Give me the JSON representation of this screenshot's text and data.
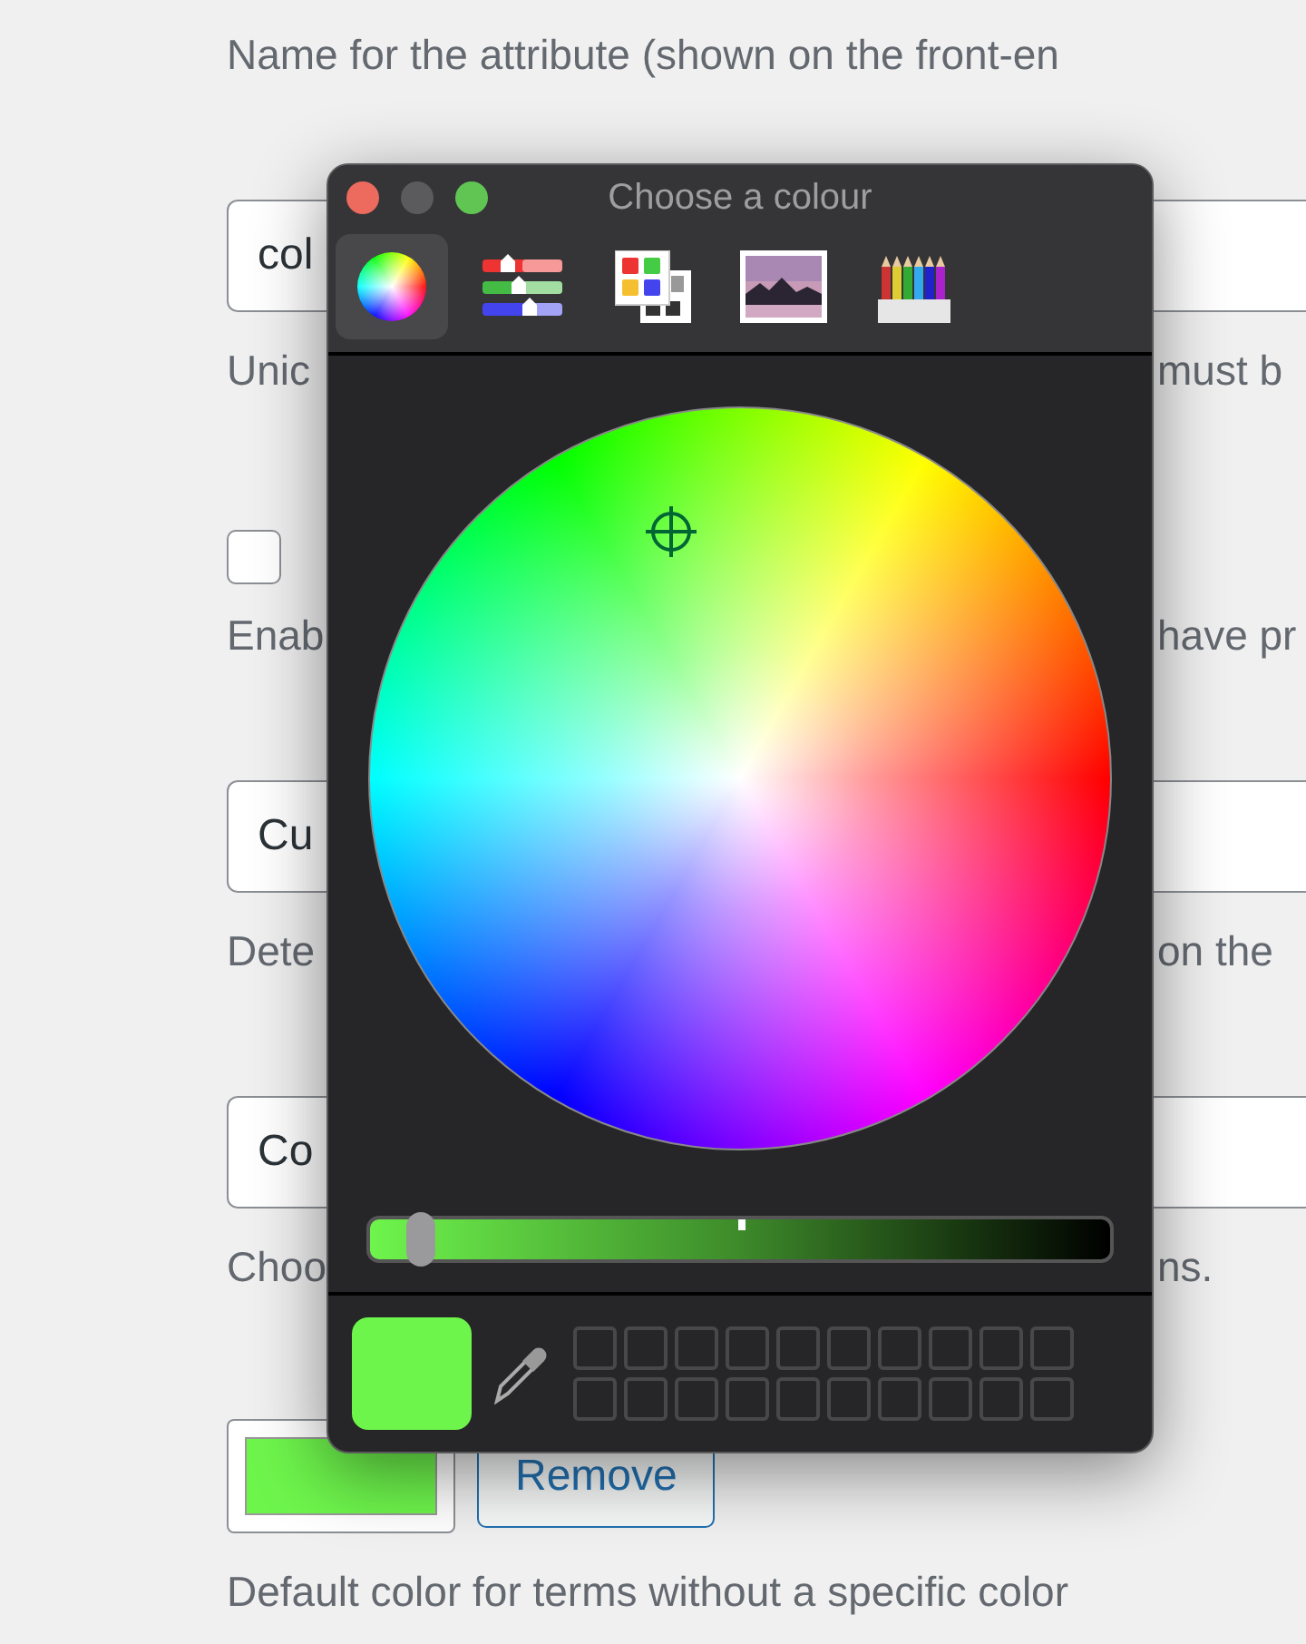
{
  "form_rows": [
    {
      "kind": "help",
      "left": "Name for the attribute (shown on the front-en"
    },
    {
      "kind": "input",
      "value": "col"
    },
    {
      "kind": "help",
      "left": "Unic",
      "right": "must b"
    },
    {
      "kind": "checkbox",
      "checked": false
    },
    {
      "kind": "help",
      "left": "Enab",
      "right": "have pr"
    },
    {
      "kind": "input",
      "value": "Cu"
    },
    {
      "kind": "help",
      "left": "Dete",
      "right": "on the"
    },
    {
      "kind": "input",
      "value": "Co"
    },
    {
      "kind": "help",
      "left": "Choo",
      "right": "ns."
    },
    {
      "kind": "color_setting",
      "color": "#6ef54c",
      "button": "Remove"
    },
    {
      "kind": "help",
      "left": "Default color for terms without a specific color"
    }
  ],
  "dialog": {
    "title": "Choose a colour",
    "window_buttons": [
      {
        "kind": "close",
        "disabled": false
      },
      {
        "kind": "minimize",
        "disabled": true
      },
      {
        "kind": "zoom",
        "disabled": false
      }
    ],
    "modes": [
      {
        "kind": "wheel",
        "selected": true
      },
      {
        "kind": "sliders",
        "selected": false
      },
      {
        "kind": "palettes",
        "selected": false
      },
      {
        "kind": "image",
        "selected": false
      },
      {
        "kind": "pencils",
        "selected": false
      }
    ],
    "brightness": {
      "level": 0.05
    }
  }
}
